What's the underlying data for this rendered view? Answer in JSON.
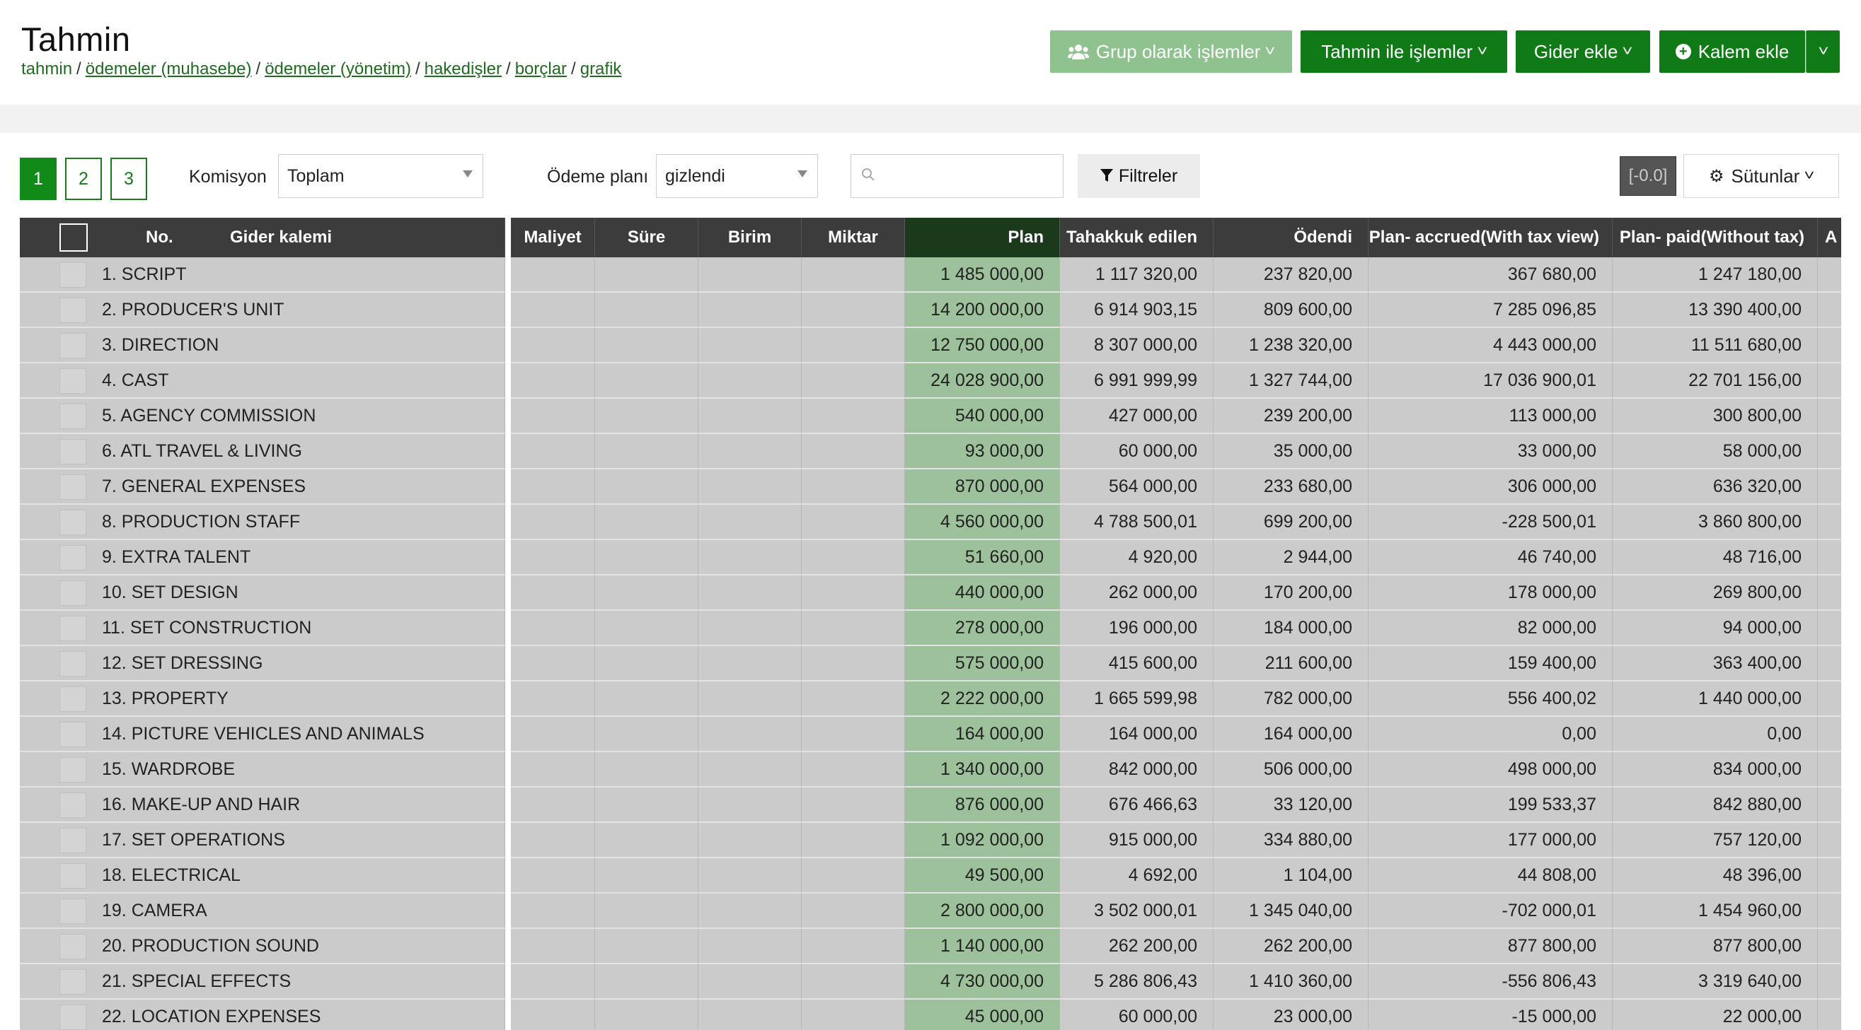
{
  "header": {
    "title": "Tahmin",
    "breadcrumb": {
      "current": "tahmin",
      "links": [
        "ödemeler (muhasebe)",
        "ödemeler (yönetim)",
        "hakedişler",
        "borçlar",
        "grafik"
      ]
    },
    "buttons": {
      "group_ops": "Grup olarak işlemler",
      "forecast_ops": "Tahmin ile işlemler",
      "add_expense": "Gider ekle",
      "add_item": "Kalem ekle"
    }
  },
  "toolbar": {
    "pages": [
      "1",
      "2",
      "3"
    ],
    "active_page": "1",
    "commission_label": "Komisyon",
    "commission_value": "Toplam",
    "payment_plan_label": "Ödeme planı",
    "payment_plan_value": "gizlendi",
    "search_placeholder": "",
    "filters_label": "Filtreler",
    "badge": "[-0.0]",
    "columns_label": "Sütunlar"
  },
  "table": {
    "headers": {
      "no": "No.",
      "expense_item": "Gider kalemi",
      "cost": "Maliyet",
      "duration": "Süre",
      "unit": "Birim",
      "quantity": "Miktar",
      "plan": "Plan",
      "accrued": "Tahakkuk edilen",
      "paid": "Ödendi",
      "plan_accrued": "Plan- accrued(With tax view)",
      "plan_paid": "Plan- paid(Without tax)",
      "next": "A"
    },
    "rows": [
      {
        "name": "1. SCRIPT",
        "plan": "1 485 000,00",
        "accrued": "1 117 320,00",
        "paid": "237 820,00",
        "plan_accrued": "367 680,00",
        "plan_paid": "1 247 180,00"
      },
      {
        "name": "2. PRODUCER'S UNIT",
        "plan": "14 200 000,00",
        "accrued": "6 914 903,15",
        "paid": "809 600,00",
        "plan_accrued": "7 285 096,85",
        "plan_paid": "13 390 400,00"
      },
      {
        "name": "3. DIRECTION",
        "plan": "12 750 000,00",
        "accrued": "8 307 000,00",
        "paid": "1 238 320,00",
        "plan_accrued": "4 443 000,00",
        "plan_paid": "11 511 680,00"
      },
      {
        "name": "4. CAST",
        "plan": "24 028 900,00",
        "accrued": "6 991 999,99",
        "paid": "1 327 744,00",
        "plan_accrued": "17 036 900,01",
        "plan_paid": "22 701 156,00"
      },
      {
        "name": "5. AGENCY COMMISSION",
        "plan": "540 000,00",
        "accrued": "427 000,00",
        "paid": "239 200,00",
        "plan_accrued": "113 000,00",
        "plan_paid": "300 800,00"
      },
      {
        "name": "6. ATL TRAVEL & LIVING",
        "plan": "93 000,00",
        "accrued": "60 000,00",
        "paid": "35 000,00",
        "plan_accrued": "33 000,00",
        "plan_paid": "58 000,00"
      },
      {
        "name": "7. GENERAL EXPENSES",
        "plan": "870 000,00",
        "accrued": "564 000,00",
        "paid": "233 680,00",
        "plan_accrued": "306 000,00",
        "plan_paid": "636 320,00"
      },
      {
        "name": "8. PRODUCTION STAFF",
        "plan": "4 560 000,00",
        "accrued": "4 788 500,01",
        "paid": "699 200,00",
        "plan_accrued": "-228 500,01",
        "plan_paid": "3 860 800,00"
      },
      {
        "name": "9. EXTRA TALENT",
        "plan": "51 660,00",
        "accrued": "4 920,00",
        "paid": "2 944,00",
        "plan_accrued": "46 740,00",
        "plan_paid": "48 716,00"
      },
      {
        "name": "10. SET DESIGN",
        "plan": "440 000,00",
        "accrued": "262 000,00",
        "paid": "170 200,00",
        "plan_accrued": "178 000,00",
        "plan_paid": "269 800,00"
      },
      {
        "name": "11. SET CONSTRUCTION",
        "plan": "278 000,00",
        "accrued": "196 000,00",
        "paid": "184 000,00",
        "plan_accrued": "82 000,00",
        "plan_paid": "94 000,00"
      },
      {
        "name": "12. SET DRESSING",
        "plan": "575 000,00",
        "accrued": "415 600,00",
        "paid": "211 600,00",
        "plan_accrued": "159 400,00",
        "plan_paid": "363 400,00"
      },
      {
        "name": "13. PROPERTY",
        "plan": "2 222 000,00",
        "accrued": "1 665 599,98",
        "paid": "782 000,00",
        "plan_accrued": "556 400,02",
        "plan_paid": "1 440 000,00"
      },
      {
        "name": "14. PICTURE VEHICLES AND ANIMALS",
        "plan": "164 000,00",
        "accrued": "164 000,00",
        "paid": "164 000,00",
        "plan_accrued": "0,00",
        "plan_paid": "0,00"
      },
      {
        "name": "15. WARDROBE",
        "plan": "1 340 000,00",
        "accrued": "842 000,00",
        "paid": "506 000,00",
        "plan_accrued": "498 000,00",
        "plan_paid": "834 000,00"
      },
      {
        "name": "16. MAKE-UP AND HAIR",
        "plan": "876 000,00",
        "accrued": "676 466,63",
        "paid": "33 120,00",
        "plan_accrued": "199 533,37",
        "plan_paid": "842 880,00"
      },
      {
        "name": "17. SET OPERATIONS",
        "plan": "1 092 000,00",
        "accrued": "915 000,00",
        "paid": "334 880,00",
        "plan_accrued": "177 000,00",
        "plan_paid": "757 120,00"
      },
      {
        "name": "18. ELECTRICAL",
        "plan": "49 500,00",
        "accrued": "4 692,00",
        "paid": "1 104,00",
        "plan_accrued": "44 808,00",
        "plan_paid": "48 396,00"
      },
      {
        "name": "19. CAMERA",
        "plan": "2 800 000,00",
        "accrued": "3 502 000,01",
        "paid": "1 345 040,00",
        "plan_accrued": "-702 000,01",
        "plan_paid": "1 454 960,00"
      },
      {
        "name": "20. PRODUCTION SOUND",
        "plan": "1 140 000,00",
        "accrued": "262 200,00",
        "paid": "262 200,00",
        "plan_accrued": "877 800,00",
        "plan_paid": "877 800,00"
      },
      {
        "name": "21. SPECIAL EFFECTS",
        "plan": "4 730 000,00",
        "accrued": "5 286 806,43",
        "paid": "1 410 360,00",
        "plan_accrued": "-556 806,43",
        "plan_paid": "3 319 640,00"
      },
      {
        "name": "22. LOCATION EXPENSES",
        "plan": "45 000,00",
        "accrued": "60 000,00",
        "paid": "23 000,00",
        "plan_accrued": "-15 000,00",
        "plan_paid": "22 000,00"
      }
    ]
  },
  "colors": {
    "brand_green": "#0f7a16",
    "light_green_button": "#8fc28f",
    "plan_column": "#9dc29b",
    "header_dark": "#3c3c3c"
  }
}
